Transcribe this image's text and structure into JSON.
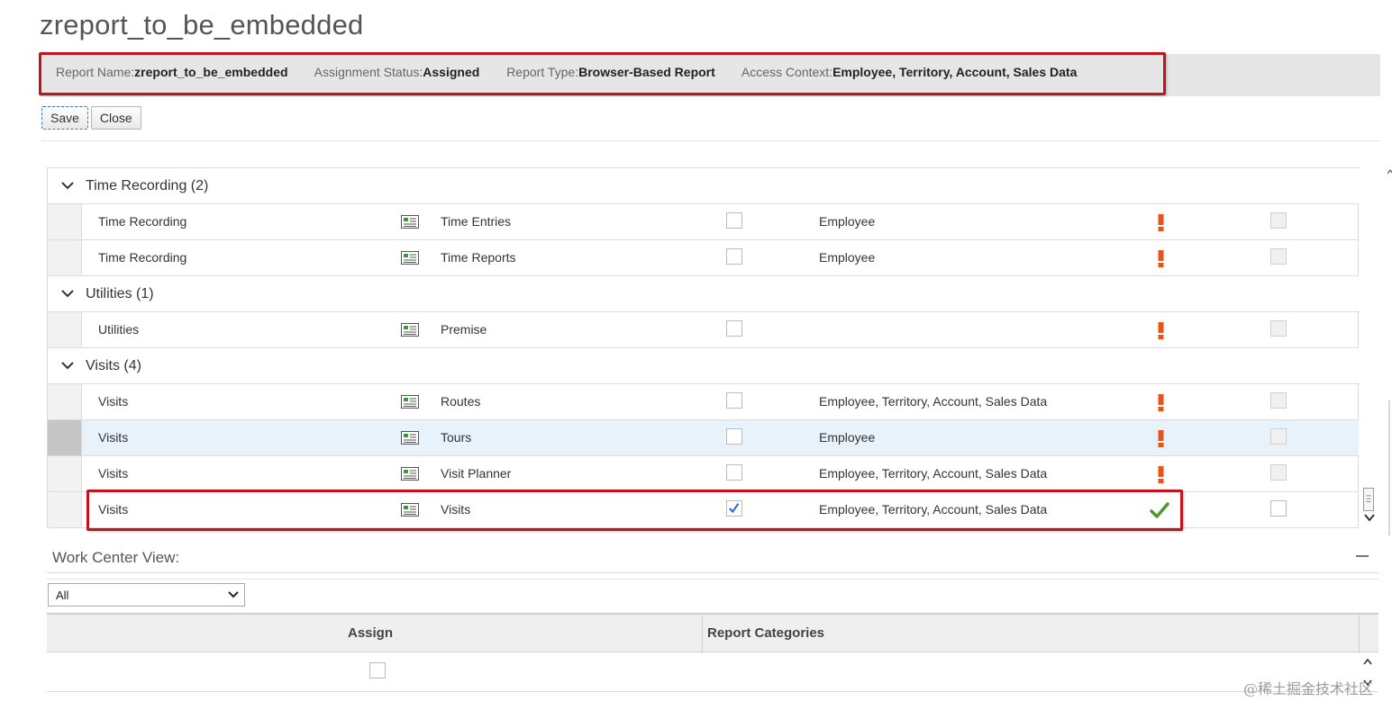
{
  "page": {
    "title": "zreport_to_be_embedded"
  },
  "info": {
    "report_name_label": "Report Name:",
    "report_name_value": "zreport_to_be_embedded",
    "status_label": "Assignment Status:",
    "status_value": "Assigned",
    "type_label": "Report Type:",
    "type_value": "Browser-Based Report",
    "context_label": "Access Context:",
    "context_value": "Employee, Territory, Account, Sales Data"
  },
  "toolbar": {
    "save_label": "Save",
    "close_label": "Close"
  },
  "groups": [
    {
      "label": "Time Recording (2)",
      "rows": [
        {
          "category": "Time Recording",
          "report": "Time Entries",
          "context": "Employee",
          "assigned": false,
          "status": "warning"
        },
        {
          "category": "Time Recording",
          "report": "Time Reports",
          "context": "Employee",
          "assigned": false,
          "status": "warning"
        }
      ]
    },
    {
      "label": "Utilities (1)",
      "rows": [
        {
          "category": "Utilities",
          "report": "Premise",
          "context": "",
          "assigned": false,
          "status": "warning"
        }
      ]
    },
    {
      "label": "Visits (4)",
      "rows": [
        {
          "category": "Visits",
          "report": "Routes",
          "context": "Employee, Territory, Account, Sales Data",
          "assigned": false,
          "status": "warning"
        },
        {
          "category": "Visits",
          "report": "Tours",
          "context": "Employee",
          "assigned": false,
          "status": "warning",
          "selected": true
        },
        {
          "category": "Visits",
          "report": "Visit Planner",
          "context": "Employee, Territory, Account, Sales Data",
          "assigned": false,
          "status": "warning"
        },
        {
          "category": "Visits",
          "report": "Visits",
          "context": "Employee, Territory, Account, Sales Data",
          "assigned": true,
          "status": "ok"
        }
      ]
    }
  ],
  "work_center": {
    "label": "Work Center View:",
    "filter_value": "All",
    "columns": {
      "assign": "Assign",
      "categories": "Report Categories"
    }
  },
  "watermark": "@稀土掘金技术社区",
  "colors": {
    "highlight_box": "#c0141f",
    "warning": "#e8521d",
    "ok": "#4a9a2e",
    "check": "#1e6fc2"
  }
}
